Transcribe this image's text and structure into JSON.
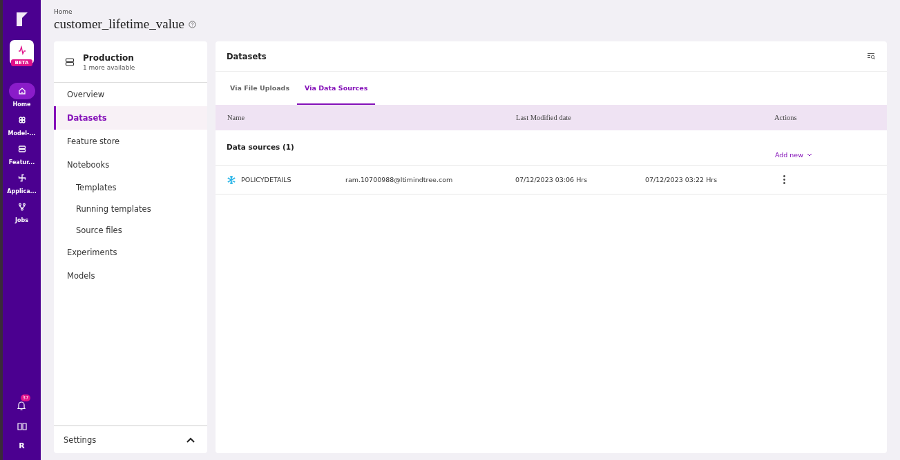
{
  "rail": {
    "items": [
      {
        "label": "Home",
        "selected": true
      },
      {
        "label": "Model-...",
        "selected": false
      },
      {
        "label": "Featur...",
        "selected": false
      },
      {
        "label": "Applica...",
        "selected": false
      },
      {
        "label": "Jobs",
        "selected": false
      }
    ],
    "beta_badge": "BETA",
    "notifications": "37",
    "avatar": "R"
  },
  "breadcrumb": "Home",
  "title": "customer_lifetime_value",
  "project": {
    "name": "Production",
    "subtitle": "1 more available"
  },
  "nav": [
    {
      "label": "Overview",
      "selected": false
    },
    {
      "label": "Datasets",
      "selected": true
    },
    {
      "label": "Feature store",
      "selected": false
    },
    {
      "label": "Notebooks",
      "selected": false,
      "children": [
        {
          "label": "Templates",
          "selected": false
        },
        {
          "label": "Running templates",
          "selected": false
        },
        {
          "label": "Source files",
          "selected": false
        }
      ]
    },
    {
      "label": "Experiments",
      "selected": false
    },
    {
      "label": "Models",
      "selected": false
    }
  ],
  "settings": {
    "label": "Settings",
    "expanded": true
  },
  "panel": {
    "title": "Datasets",
    "tabs": [
      {
        "label": "Via File Uploads",
        "selected": false
      },
      {
        "label": "Via Data Sources",
        "selected": true
      }
    ],
    "columns": [
      "Name",
      "Last Modified date",
      "Actions"
    ],
    "group": {
      "title": "Data sources (1)",
      "add": "Add new"
    },
    "rows": [
      {
        "name": "POLICYDETAILS",
        "owner": "ram.10700988@ltimindtree.com",
        "created": "07/12/2023 03:06 Hrs",
        "modified": "07/12/2023 03:22 Hrs"
      }
    ]
  }
}
